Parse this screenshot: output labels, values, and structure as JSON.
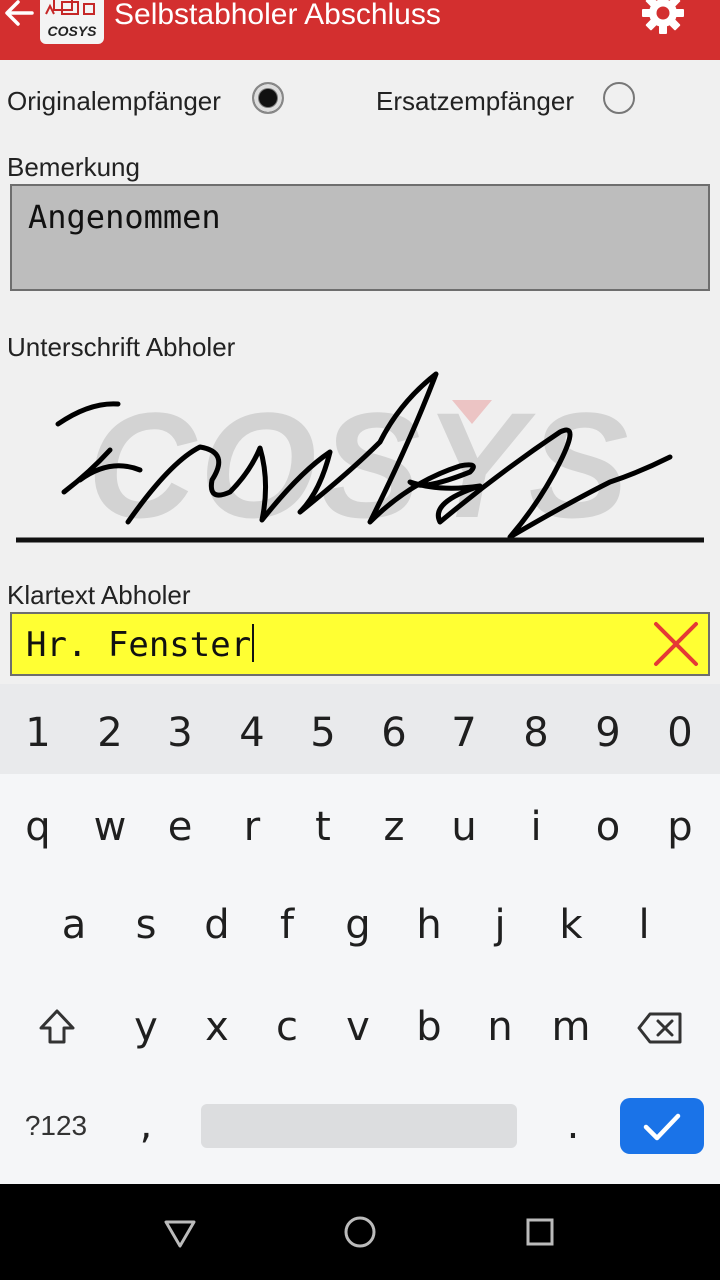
{
  "appbar": {
    "title": "Selbstabholer Abschluss",
    "logo_text": "COSYS",
    "color": "#d32f2f"
  },
  "recipient": {
    "original_label": "Originalempfänger",
    "original_checked": true,
    "substitute_label": "Ersatzempfänger",
    "substitute_checked": false
  },
  "remark": {
    "label": "Bemerkung",
    "value": "Angenommen"
  },
  "signature": {
    "label": "Unterschrift Abholer",
    "watermark": "COSYS"
  },
  "cleartext": {
    "label": "Klartext Abholer",
    "value": "Hr. Fenster",
    "field_color": "#ffff33"
  },
  "keyboard": {
    "numbers": [
      "1",
      "2",
      "3",
      "4",
      "5",
      "6",
      "7",
      "8",
      "9",
      "0"
    ],
    "row1": [
      "q",
      "w",
      "e",
      "r",
      "t",
      "z",
      "u",
      "i",
      "o",
      "p"
    ],
    "row2": [
      "a",
      "s",
      "d",
      "f",
      "g",
      "h",
      "j",
      "k",
      "l"
    ],
    "row3": [
      "y",
      "x",
      "c",
      "v",
      "b",
      "n",
      "m"
    ],
    "symbols_label": "?123",
    "comma": ",",
    "period": ".",
    "enter_color": "#1a73e8"
  }
}
